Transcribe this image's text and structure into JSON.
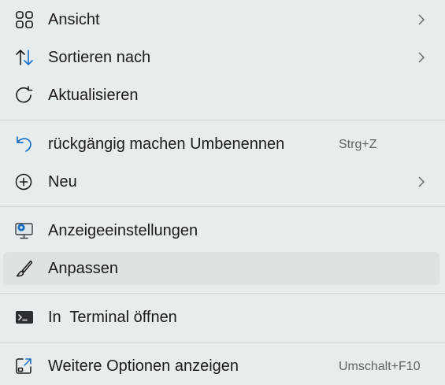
{
  "menu": {
    "items": [
      {
        "label": "Ansicht",
        "icon": "grid-icon",
        "submenu": true
      },
      {
        "label": "Sortieren nach",
        "icon": "sort-arrows-icon",
        "submenu": true
      },
      {
        "label": "Aktualisieren",
        "icon": "refresh-icon",
        "submenu": false
      },
      {
        "label": "rückgängig machen Umbenennen",
        "icon": "undo-icon",
        "shortcut": "Strg+Z"
      },
      {
        "label": "Neu",
        "icon": "plus-circle-icon",
        "submenu": true
      },
      {
        "label": "Anzeigeeinstellungen",
        "icon": "display-settings-icon"
      },
      {
        "label": "Anpassen",
        "icon": "brush-icon",
        "hovered": true
      },
      {
        "label": "In  Terminal öffnen",
        "icon": "terminal-icon"
      },
      {
        "label": "Weitere Optionen anzeigen",
        "icon": "open-external-icon",
        "shortcut": "Umschalt+F10"
      }
    ]
  },
  "colors": {
    "background": "#e7edef",
    "hover": "#dde3e5",
    "accent": "#1a6fc4",
    "separator": "#cfd5d7"
  }
}
